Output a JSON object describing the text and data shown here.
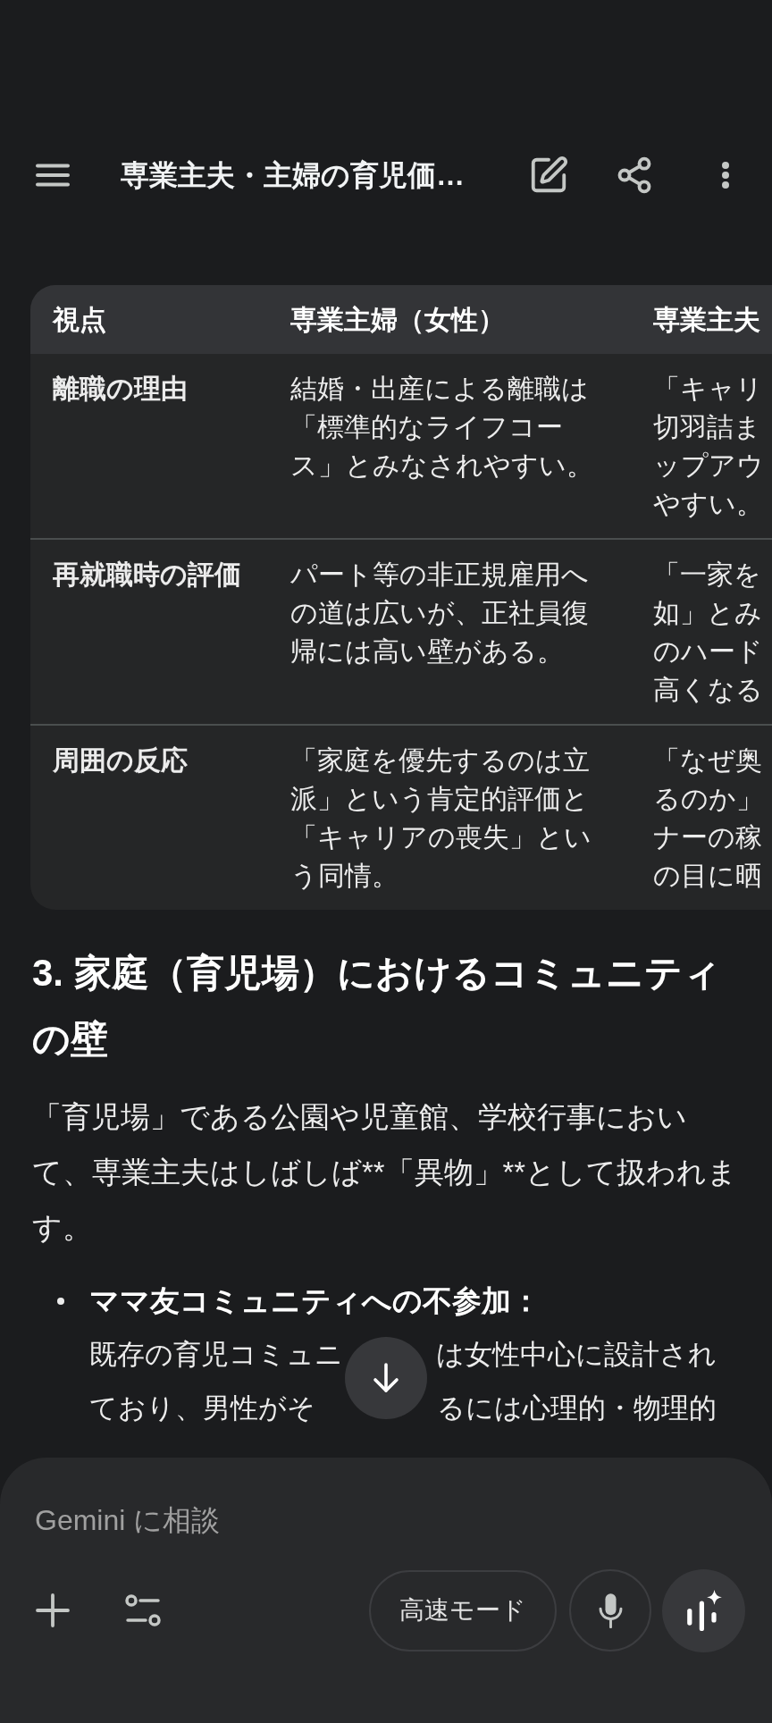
{
  "header": {
    "title": "専業主夫・主婦の育児価…"
  },
  "table": {
    "columns": [
      "視点",
      "専業主婦（女性）",
      "専業主夫"
    ],
    "rows": [
      {
        "cells": [
          {
            "text": "離職の理由"
          },
          {
            "text": "結婚・出産による離職は「標準的なライフコース」とみなされやすい。"
          },
          {
            "lines": [
              "「キャリ",
              "切羽詰ま",
              "ップアウ",
              "やすい。"
            ]
          }
        ]
      },
      {
        "cells": [
          {
            "text": "再就職時の評価"
          },
          {
            "text": "パート等の非正規雇用への道は広いが、正社員復帰には高い壁がある。"
          },
          {
            "lines": [
              "「一家を",
              "如」とみ",
              "のハード",
              "高くなる"
            ]
          }
        ]
      },
      {
        "cells": [
          {
            "text": "周囲の反応"
          },
          {
            "text": "「家庭を優先するのは立派」という肯定的評価と「キャリアの喪失」という同情。"
          },
          {
            "lines": [
              "「なぜ奥",
              "るのか」",
              "ナーの稼",
              "の目に晒"
            ]
          }
        ]
      }
    ]
  },
  "section": {
    "heading": "3. 家庭（育児場）におけるコミュニティの壁",
    "paragraph": "「育児場」である公園や児童館、学校行事において、専業主夫はしばしば**「異物」**として扱われます。",
    "bullets": [
      {
        "title": "ママ友コミュニティへの不参加：",
        "lines": [
          [
            "既存の育児コミュニ",
            "は女性中心に設計され"
          ],
          [
            "ており、男性がそ",
            "るには心理的・物理的"
          ]
        ]
      }
    ]
  },
  "composer": {
    "placeholder": "Gemini に相談",
    "mode_button": "高速モード"
  }
}
